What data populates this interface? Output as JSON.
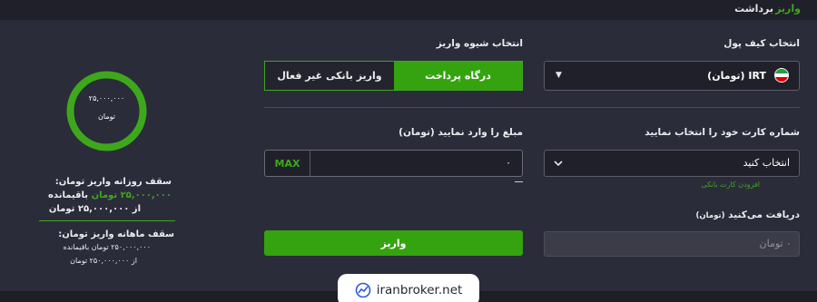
{
  "topbar": {
    "deposit_tab": "واریز",
    "withdraw_tab": "برداشت"
  },
  "wallet": {
    "label": "انتخاب کیف پول",
    "selected": "IRT (تومان)"
  },
  "method": {
    "label": "انتخاب شیوه واریز",
    "active": "درگاه پرداخت",
    "inactive": "واریز بانکی غیر فعال"
  },
  "card": {
    "label": "شماره کارت خود را انتخاب نمایید",
    "placeholder": "انتخاب کنید",
    "add_link": "افزودن کارت بانکی"
  },
  "amount": {
    "label": "مبلغ را وارد نمایید (تومان)",
    "max": "MAX",
    "value": "۰"
  },
  "receive": {
    "label": "دریافت می‌کنید",
    "unit": "(تومان)",
    "value": "۰ تومان"
  },
  "submit_label": "واریز",
  "gauge": {
    "amount": "۲۵,۰۰۰,۰۰۰",
    "unit": "تومان",
    "fill_fraction": 1.0,
    "color": "#3ea81c"
  },
  "limits": {
    "daily_title": "سقف روزانه واریز تومان:",
    "daily_remaining_amount": "۲۵,۰۰۰,۰۰۰ تومان",
    "daily_remaining_label": "باقیمانده",
    "daily_of": "از ۲۵,۰۰۰,۰۰۰ تومان",
    "monthly_title": "سقف ماهانه واریز تومان:",
    "monthly_remaining": "۲۵۰,۰۰۰,۰۰۰ تومان باقیمانده",
    "monthly_of": "از ۲۵۰,۰۰۰,۰۰۰ تومان"
  },
  "watermark": {
    "text": "iranbroker.net"
  },
  "icons": {
    "flag": "iran-flag-icon",
    "caret_wallet": "caret-down-icon",
    "caret_card": "chevron-down-icon",
    "logo": "chart-logo-icon"
  },
  "colors": {
    "accent": "#34a30f",
    "background": "#2b2c3a",
    "field": "#1f2029"
  }
}
